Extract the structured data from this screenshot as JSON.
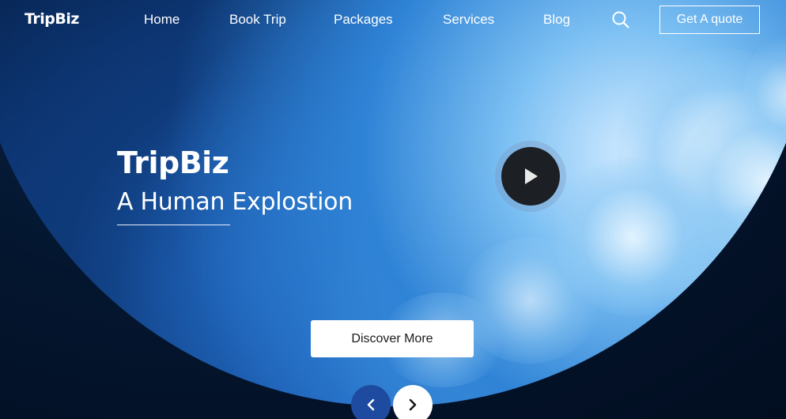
{
  "brand": {
    "name": "TripBiz"
  },
  "nav": {
    "items": [
      {
        "label": "Home"
      },
      {
        "label": "Book Trip"
      },
      {
        "label": "Packages"
      },
      {
        "label": "Services"
      },
      {
        "label": "Blog"
      }
    ],
    "search_icon": "search-icon",
    "quote_label": "Get A quote"
  },
  "hero": {
    "title": "TripBiz",
    "subtitle": "A Human Explostion",
    "play_icon": "play-icon",
    "cta_label": "Discover More"
  },
  "slider": {
    "prev_icon": "chevron-left-icon",
    "next_icon": "chevron-right-icon"
  },
  "colors": {
    "background": "#02112b",
    "accent": "#1e4aa0",
    "button_light": "#ffffff",
    "play_button": "#1c1f24"
  }
}
